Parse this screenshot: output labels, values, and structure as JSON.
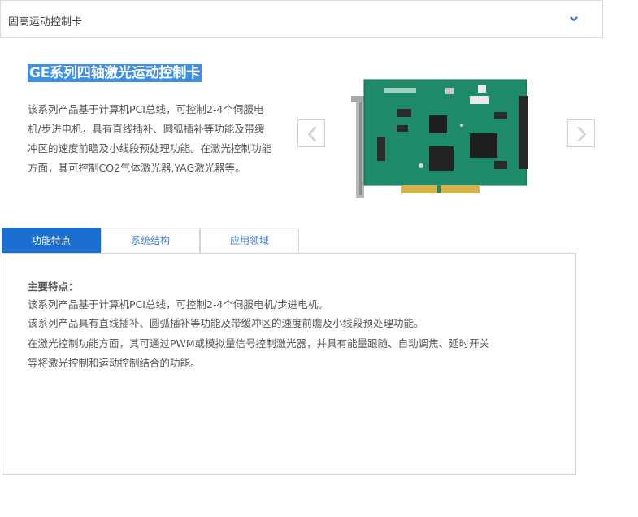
{
  "category_select": {
    "selected": "固高运动控制卡",
    "icon": "chevron-down-icon"
  },
  "product": {
    "title": "GE系列四轴激光运动控制卡",
    "description_lines": [
      "该系列产品基于计算机PCI总线，可控制2-4个伺服电",
      "机/步进电机，具有直线插补、圆弧插补等功能及带缓",
      "冲区的速度前瞻及小线段预处理功能。在激光控制功能",
      "方面，其可控制CO2气体激光器,YAG激光器等。"
    ]
  },
  "carousel": {
    "prev_icon": "chevron-left-icon",
    "next_icon": "chevron-right-icon"
  },
  "tabs": [
    {
      "label": "功能特点",
      "active": true
    },
    {
      "label": "系统结构",
      "active": false
    },
    {
      "label": "应用领域",
      "active": false
    }
  ],
  "features": {
    "heading": "主要特点：",
    "lines": [
      "该系列产品基于计算机PCI总线，可控制2-4个伺服电机/步进电机。",
      "该系列产品具有直线插补、圆弧插补等功能及带缓冲区的速度前瞻及小线段预处理功能。",
      "在激光控制功能方面，其可通过PWM或模拟量信号控制激光器，并具有能量跟随、自动调焦、延时开关",
      "等将激光控制和运动控制结合的功能。"
    ]
  },
  "colors": {
    "accent": "#1a6fd1",
    "title_highlight": "#3e8fe6",
    "pcb_green": "#1f8a6a"
  }
}
